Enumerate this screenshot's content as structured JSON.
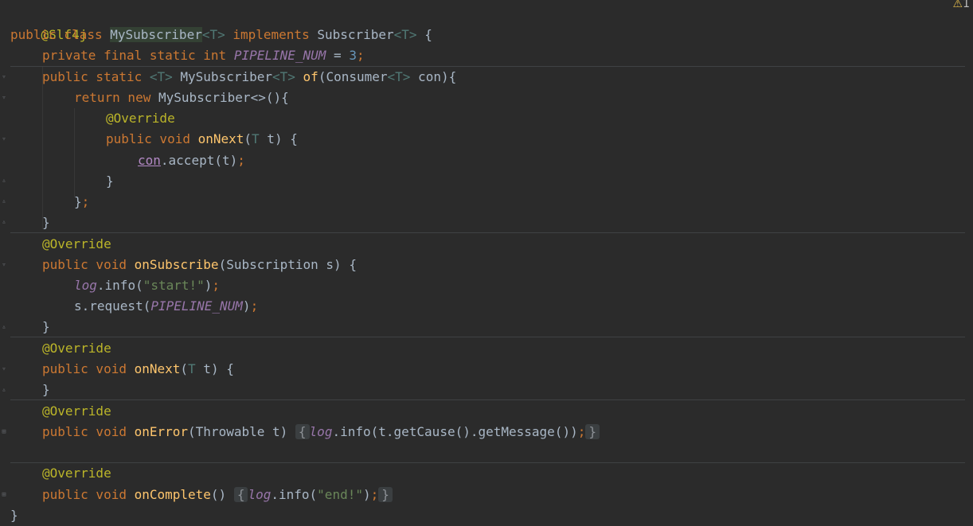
{
  "warning": {
    "icon": "warning-triangle-icon",
    "count": "1"
  },
  "colors": {
    "background": "#2b2b2b",
    "keyword": "#cc7832",
    "annotation": "#bbb529",
    "function": "#ffc66d",
    "field": "#9876aa",
    "string": "#6a8759",
    "number": "#6897bb"
  },
  "code": {
    "l1": "@Slf4j",
    "l2": {
      "kw": "public class ",
      "name": "MySubscriber",
      "t1": "<T>",
      "impl": " implements ",
      "iface": "Subscriber",
      "t2": "<T>",
      "brace": " {"
    },
    "l3": {
      "kw": "private final static int ",
      "field": "PIPELINE_NUM",
      "eq": " = ",
      "num": "3",
      "semi": ";"
    },
    "l4": {
      "kw": "public static ",
      "t1": "<T>",
      "sp": " MySubscriber",
      "t2": "<T>",
      "sp2": " ",
      "fn": "of",
      "params": "(Consumer",
      "t3": "<T>",
      "rest": " con){"
    },
    "l5": {
      "kw": "return new ",
      "rest": "MySubscriber<>(){"
    },
    "l6": "@Override",
    "l7": {
      "kw": "public void ",
      "fn": "onNext",
      "p1": "(",
      "t": "T",
      "rest": " t) {"
    },
    "l8": {
      "cap": "con",
      "rest": ".accept(t)",
      "semi": ";"
    },
    "l9": "}",
    "l10": {
      "rest": "}",
      "semi": ";"
    },
    "l11": "}",
    "l12": "@Override",
    "l13": {
      "kw": "public void ",
      "fn": "onSubscribe",
      "rest": "(Subscription s) {"
    },
    "l14": {
      "field": "log",
      "rest": ".info(",
      "str": "\"start!\"",
      "close": ")",
      "semi": ";"
    },
    "l15": {
      "rest": "s.request(",
      "field": "PIPELINE_NUM",
      "close": ")",
      "semi": ";"
    },
    "l16": "}",
    "l17": "@Override",
    "l18": {
      "kw": "public void ",
      "fn": "onNext",
      "p1": "(",
      "t": "T",
      "rest": " t) {"
    },
    "l19": "}",
    "l20": "@Override",
    "l21": {
      "kw": "public void ",
      "fn": "onError",
      "rest": "(Throwable t)",
      "ob": "{",
      "field": "log",
      "body": ".info(t.getCause().getMessage())",
      "semi": ";",
      "cb": "}"
    },
    "l22": "@Override",
    "l23": {
      "kw": "public void ",
      "fn": "onComplete",
      "rest": "()",
      "ob": "{",
      "field": "log",
      "body": ".info(",
      "str": "\"end!\"",
      "close": ")",
      "semi": ";",
      "cb": "}"
    },
    "l24": "}"
  }
}
